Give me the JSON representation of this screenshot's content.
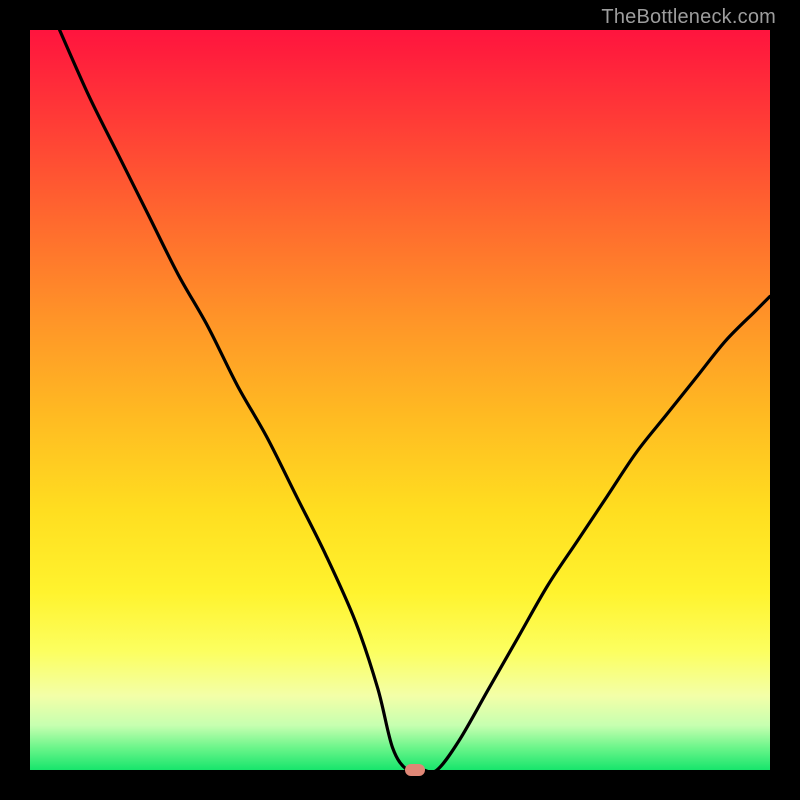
{
  "watermark": "TheBottleneck.com",
  "chart_data": {
    "type": "line",
    "title": "",
    "xlabel": "",
    "ylabel": "",
    "xlim": [
      0,
      100
    ],
    "ylim": [
      0,
      100
    ],
    "series": [
      {
        "name": "curve",
        "x": [
          4,
          8,
          12,
          16,
          20,
          24,
          28,
          32,
          36,
          40,
          44,
          47,
          49,
          51,
          53,
          55,
          58,
          62,
          66,
          70,
          74,
          78,
          82,
          86,
          90,
          94,
          98,
          100
        ],
        "y": [
          100,
          91,
          83,
          75,
          67,
          60,
          52,
          45,
          37,
          29,
          20,
          11,
          3,
          0,
          0,
          0,
          4,
          11,
          18,
          25,
          31,
          37,
          43,
          48,
          53,
          58,
          62,
          64
        ]
      }
    ],
    "minimum_marker": {
      "x": 52,
      "y": 0
    },
    "background_gradient": {
      "top": "#ff143e",
      "mid": "#ffde20",
      "bottom": "#17e56c"
    }
  }
}
